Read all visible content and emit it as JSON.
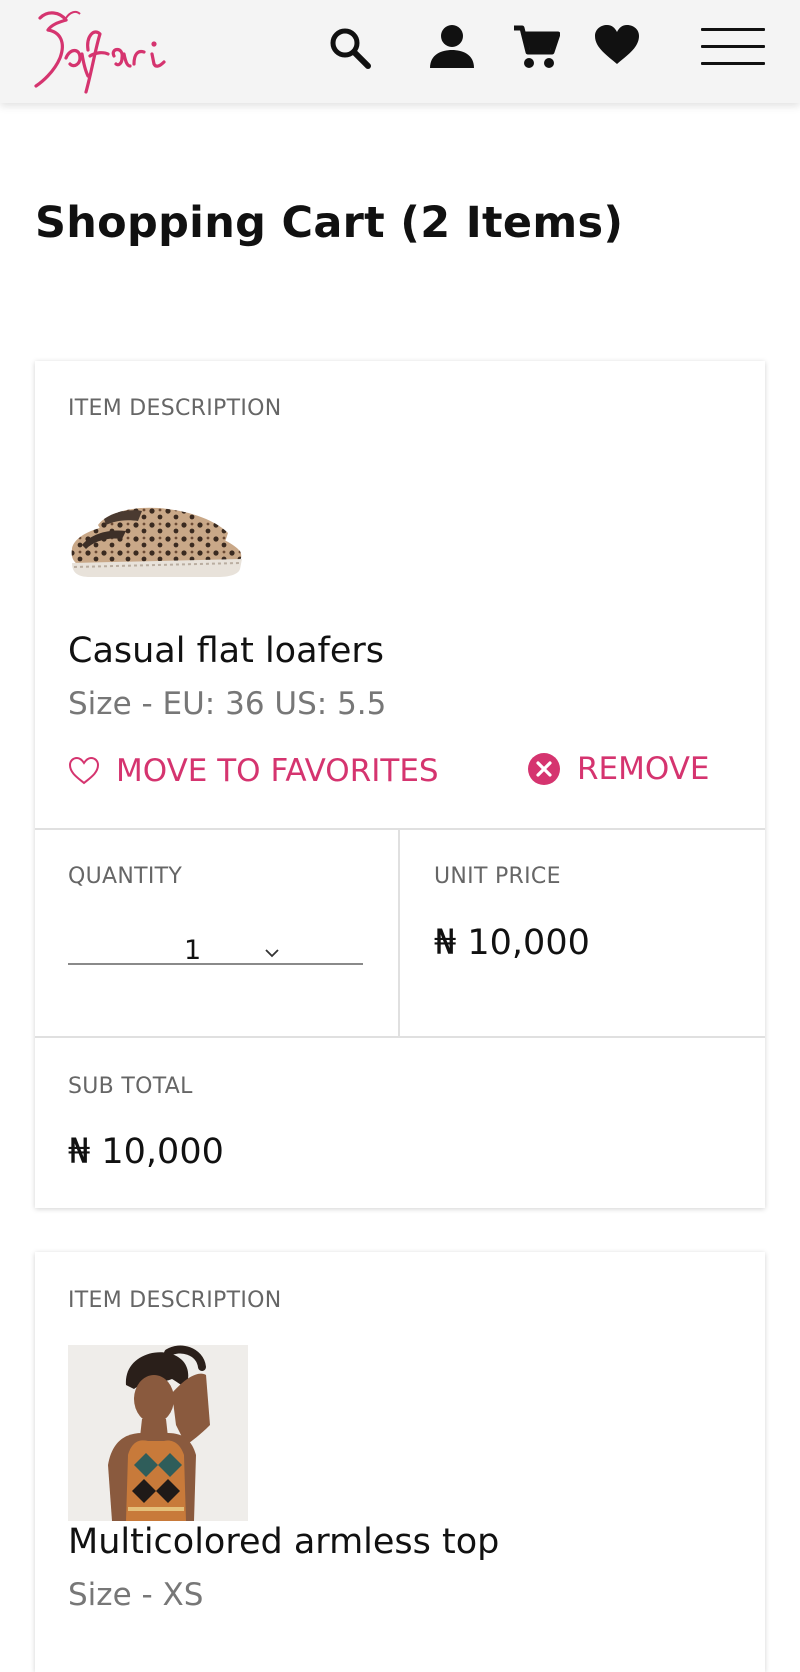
{
  "header": {
    "logo_text": "Safari",
    "icons": [
      "search-icon",
      "user-icon",
      "cart-icon",
      "heart-icon",
      "menu-icon"
    ]
  },
  "page": {
    "title": "Shopping Cart (2 Items)"
  },
  "cart_items": [
    {
      "description_label": "ITEM DESCRIPTION",
      "name": "Casual flat loafers",
      "size": "Size - EU: 36 US: 5.5",
      "favorite_label": "MOVE TO FAVORITES",
      "remove_label": "REMOVE",
      "quantity_label": "QUANTITY",
      "quantity": "1",
      "unit_price_label": "UNIT PRICE",
      "unit_price": "₦ 10,000",
      "subtotal_label": "SUB TOTAL",
      "subtotal": "₦ 10,000"
    },
    {
      "description_label": "ITEM DESCRIPTION",
      "name": "Multicolored armless top",
      "size": "Size - XS"
    }
  ],
  "colors": {
    "accent": "#d5346f",
    "header_bg": "#f4f4f4",
    "text": "#111111",
    "muted": "#666666"
  }
}
